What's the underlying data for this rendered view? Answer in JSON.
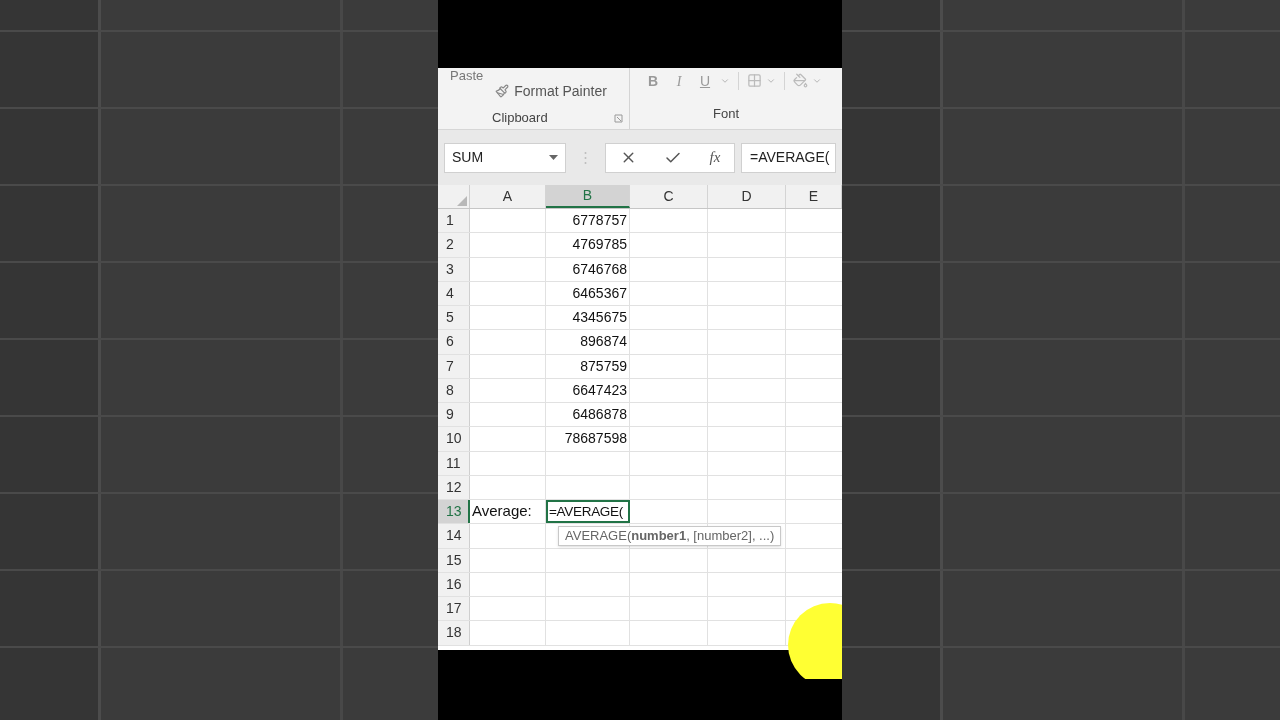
{
  "ribbon": {
    "paste": "Paste",
    "format_painter": "Format Painter",
    "clipboard_label": "Clipboard",
    "font_buttons": [
      "B",
      "I",
      "U"
    ],
    "font_label": "Font"
  },
  "formula_bar": {
    "name_box": "SUM",
    "function_label": "fx",
    "formula": "=AVERAGE("
  },
  "columns": [
    {
      "label": "A",
      "selected": false
    },
    {
      "label": "B",
      "selected": true
    },
    {
      "label": "C",
      "selected": false
    },
    {
      "label": "D",
      "selected": false
    },
    {
      "label": "E",
      "selected": false
    }
  ],
  "rows": [
    {
      "number": "1",
      "selected": false,
      "b": "6778757"
    },
    {
      "number": "2",
      "selected": false,
      "b": "4769785"
    },
    {
      "number": "3",
      "selected": false,
      "b": "6746768"
    },
    {
      "number": "4",
      "selected": false,
      "b": "6465367"
    },
    {
      "number": "5",
      "selected": false,
      "b": "4345675"
    },
    {
      "number": "6",
      "selected": false,
      "b": "896874"
    },
    {
      "number": "7",
      "selected": false,
      "b": "875759"
    },
    {
      "number": "8",
      "selected": false,
      "b": "6647423"
    },
    {
      "number": "9",
      "selected": false,
      "b": "6486878"
    },
    {
      "number": "10",
      "selected": false,
      "b": "78687598"
    },
    {
      "number": "11",
      "selected": false
    },
    {
      "number": "12",
      "selected": false
    },
    {
      "number": "13",
      "selected": true,
      "a": "Average:",
      "b": "=AVERAGE(",
      "editing": true
    },
    {
      "number": "14",
      "selected": false
    },
    {
      "number": "15",
      "selected": false
    },
    {
      "number": "16",
      "selected": false
    },
    {
      "number": "17",
      "selected": false
    },
    {
      "number": "18",
      "selected": false
    }
  ],
  "tooltip": "AVERAGE(**number1**, [number2], ...)"
}
